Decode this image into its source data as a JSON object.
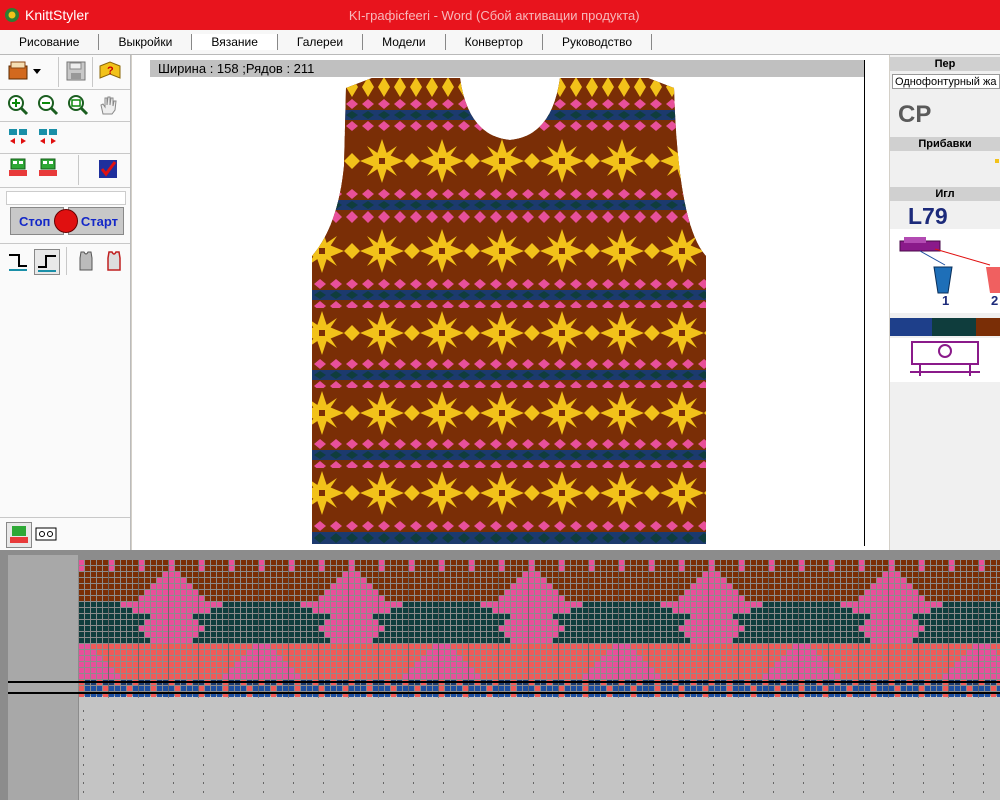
{
  "app": {
    "title": "KnittStyler",
    "doc_title": "KI-графiсfeeri - Word (Сбой активации продукта)"
  },
  "menu": [
    "Рисование",
    "Выкройки",
    "Вязание",
    "Галереи",
    "Модели",
    "Конвертор",
    "Руководство"
  ],
  "menu_active": 2,
  "tools": {
    "stop_label": "Стоп",
    "start_label": "Старт"
  },
  "canvas": {
    "info": "Ширина : 158 ;Рядов  : 211"
  },
  "right_panel": {
    "header1": "Пер",
    "type_field": "Однофонтурный жа",
    "size": "СР",
    "header2": "Прибавки",
    "header3": "Игл",
    "needle": "L79",
    "spool_labels": [
      "1",
      "2"
    ]
  },
  "colors": {
    "brown": "#7a2e06",
    "gold": "#f2c21a",
    "pink": "#e8509a",
    "navy": "#1c3a6e",
    "teal": "#0f3d3d",
    "coral": "#f05a58",
    "blue": "#1e4fa0",
    "title_red": "#e8141d"
  },
  "pattern": {
    "stitches": 158,
    "rows": 211
  }
}
